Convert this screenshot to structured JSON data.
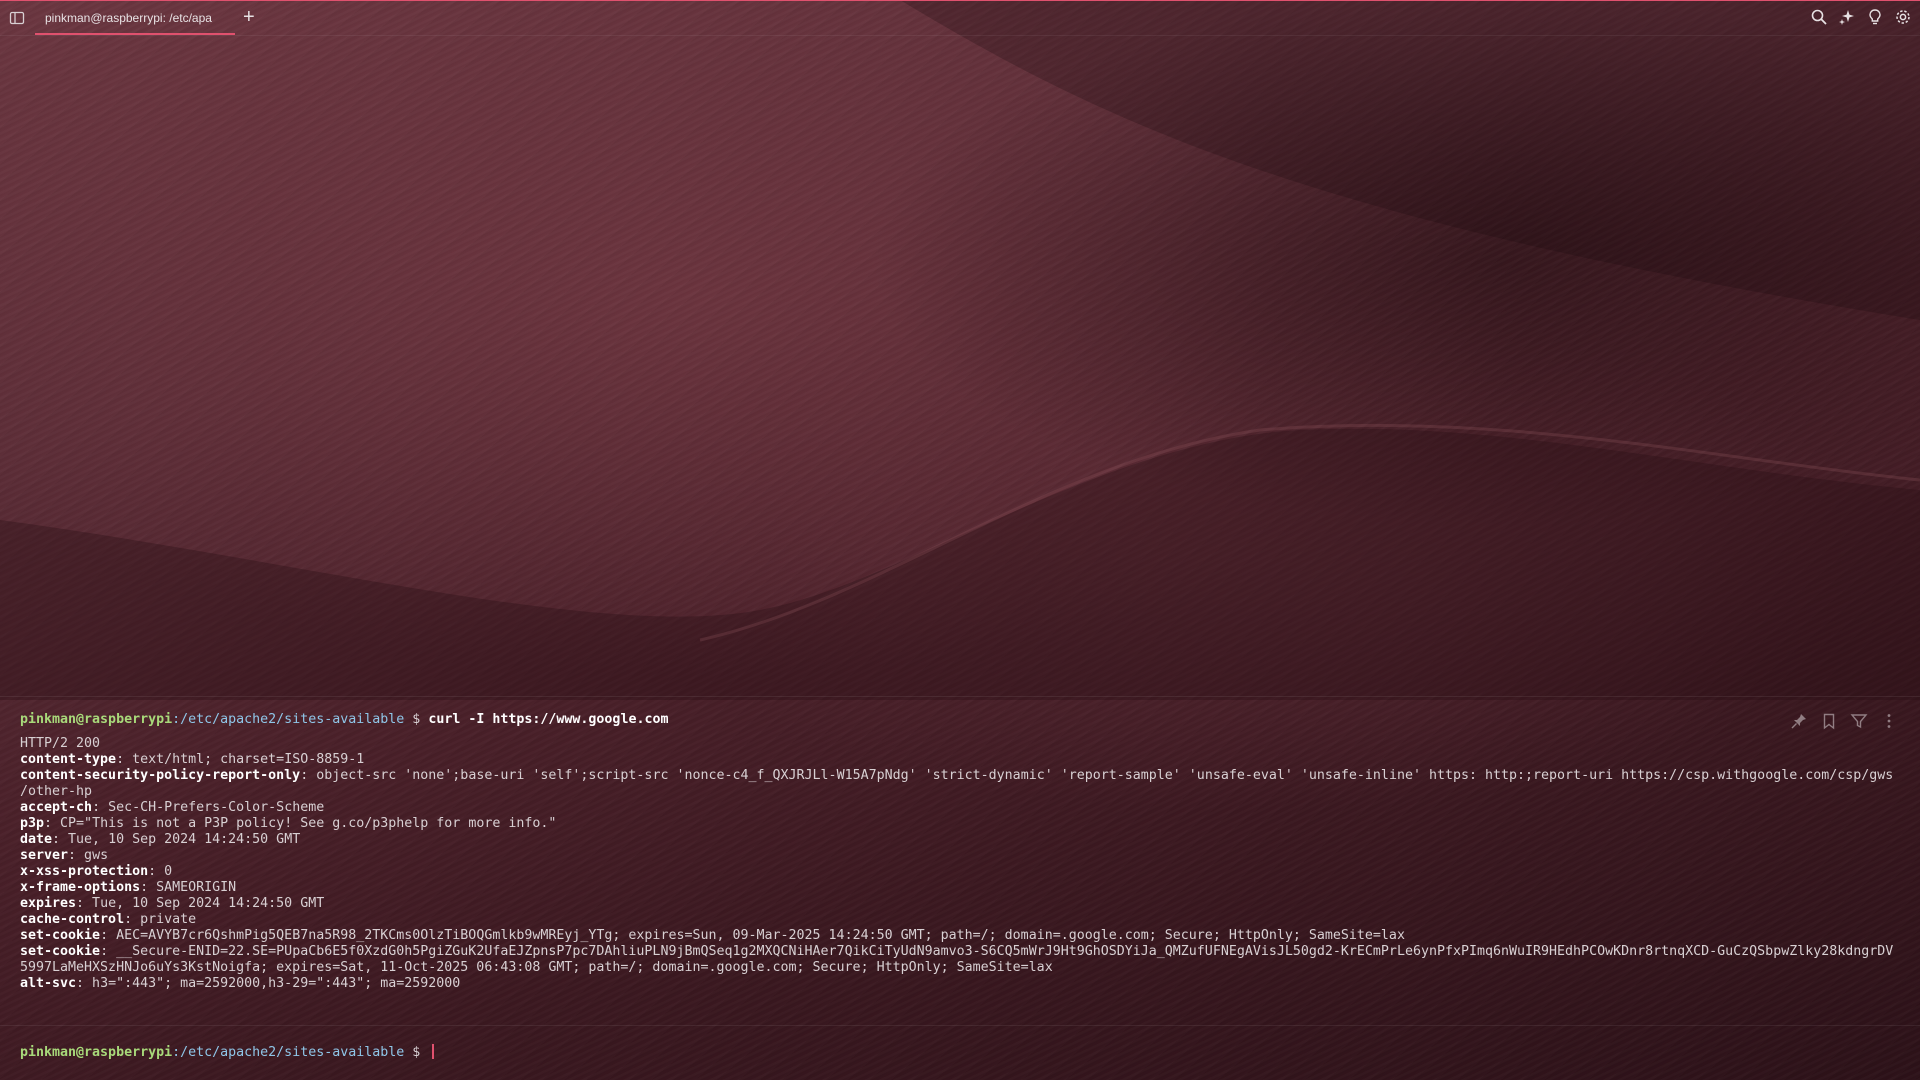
{
  "window": {
    "tab_title": "pinkman@raspberrypi: /etc/apa",
    "new_tab_label": "+",
    "accent_color": "#e0516e"
  },
  "icons": {
    "left": "panel-icon",
    "top_right": [
      "search-icon",
      "sparkle-icon",
      "lightbulb-icon",
      "settings-icon"
    ],
    "block_actions": [
      "pin-icon",
      "bookmark-icon",
      "filter-icon",
      "more-icon"
    ]
  },
  "block": {
    "prompt": {
      "user": "pinkman@raspberrypi",
      "path": ":/etc/apache2/sites-available",
      "symbol": " $ ",
      "command": "curl -I https://www.google.com"
    },
    "status_line": "HTTP/2 200",
    "headers": [
      {
        "key": "content-type",
        "value": ": text/html; charset=ISO-8859-1"
      },
      {
        "key": "content-security-policy-report-only",
        "value": ": object-src 'none';base-uri 'self';script-src 'nonce-c4_f_QXJRJLl-W15A7pNdg' 'strict-dynamic' 'report-sample' 'unsafe-eval' 'unsafe-inline' https: http:;report-uri https://csp.withgoogle.com/csp/gws",
        "continuation": "/other-hp"
      },
      {
        "key": "accept-ch",
        "value": ": Sec-CH-Prefers-Color-Scheme"
      },
      {
        "key": "p3p",
        "value": ": CP=\"This is not a P3P policy! See g.co/p3phelp for more info.\""
      },
      {
        "key": "date",
        "value": ": Tue, 10 Sep 2024 14:24:50 GMT"
      },
      {
        "key": "server",
        "value": ": gws"
      },
      {
        "key": "x-xss-protection",
        "value": ": 0"
      },
      {
        "key": "x-frame-options",
        "value": ": SAMEORIGIN"
      },
      {
        "key": "expires",
        "value": ": Tue, 10 Sep 2024 14:24:50 GMT"
      },
      {
        "key": "cache-control",
        "value": ": private"
      },
      {
        "key": "set-cookie",
        "value": ": AEC=AVYB7cr6QshmPig5QEB7na5R98_2TKCms0OlzTiBOQGmlkb9wMREyj_YTg; expires=Sun, 09-Mar-2025 14:24:50 GMT; path=/; domain=.google.com; Secure; HttpOnly; SameSite=lax"
      },
      {
        "key": "set-cookie",
        "value": ": __Secure-ENID=22.SE=PUpaCb6E5f0XzdG0h5PgiZGuK2UfaEJZpnsP7pc7DAhliuPLN9jBmQSeq1g2MXQCNiHAer7QikCiTyUdN9amvo3-S6CQ5mWrJ9Ht9GhOSDYiJa_QMZufUFNEgAVisJL50gd2-KrECmPrLe6ynPfxPImq6nWuIR9HEdhPCOwKDnr8rtnqXCD-GuCzQSbpwZlky28kdngrDV",
        "continuation": "5997LaMeHXSzHNJo6uYs3KstNoigfa; expires=Sat, 11-Oct-2025 06:43:08 GMT; path=/; domain=.google.com; Secure; HttpOnly; SameSite=lax"
      },
      {
        "key": "alt-svc",
        "value": ": h3=\":443\"; ma=2592000,h3-29=\":443\"; ma=2592000"
      }
    ]
  },
  "input": {
    "user": "pinkman@raspberrypi",
    "path": ":/etc/apache2/sites-available",
    "symbol": " $ "
  }
}
